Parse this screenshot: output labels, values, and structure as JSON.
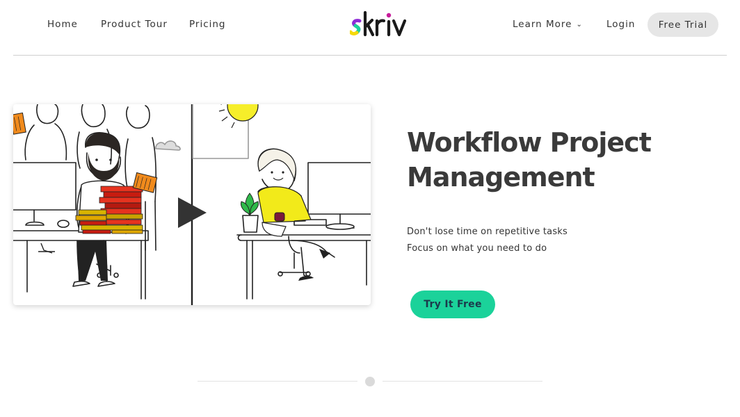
{
  "nav": {
    "home": "Home",
    "product_tour": "Product Tour",
    "pricing": "Pricing",
    "learn_more": "Learn More",
    "login": "Login",
    "free_trial": "Free Trial",
    "chevron_icon": "chevron-down-icon"
  },
  "brand": {
    "logo_text": "skriv",
    "colors": {
      "s_yellow": "#f5d90a",
      "s_green": "#1bd29a",
      "s_purple": "#8e2bd6",
      "i_dot": "#c71b9a"
    }
  },
  "hero": {
    "title": "Workflow Project Management",
    "subtitle_line1": "Don't lose time on repetitive tasks",
    "subtitle_line2": "Focus on what you need to do",
    "cta": "Try It Free",
    "video_play_icon": "play-icon"
  },
  "colors": {
    "accent": "#1bd29a",
    "trial_bg": "#e6e6e6",
    "text": "#333333"
  }
}
